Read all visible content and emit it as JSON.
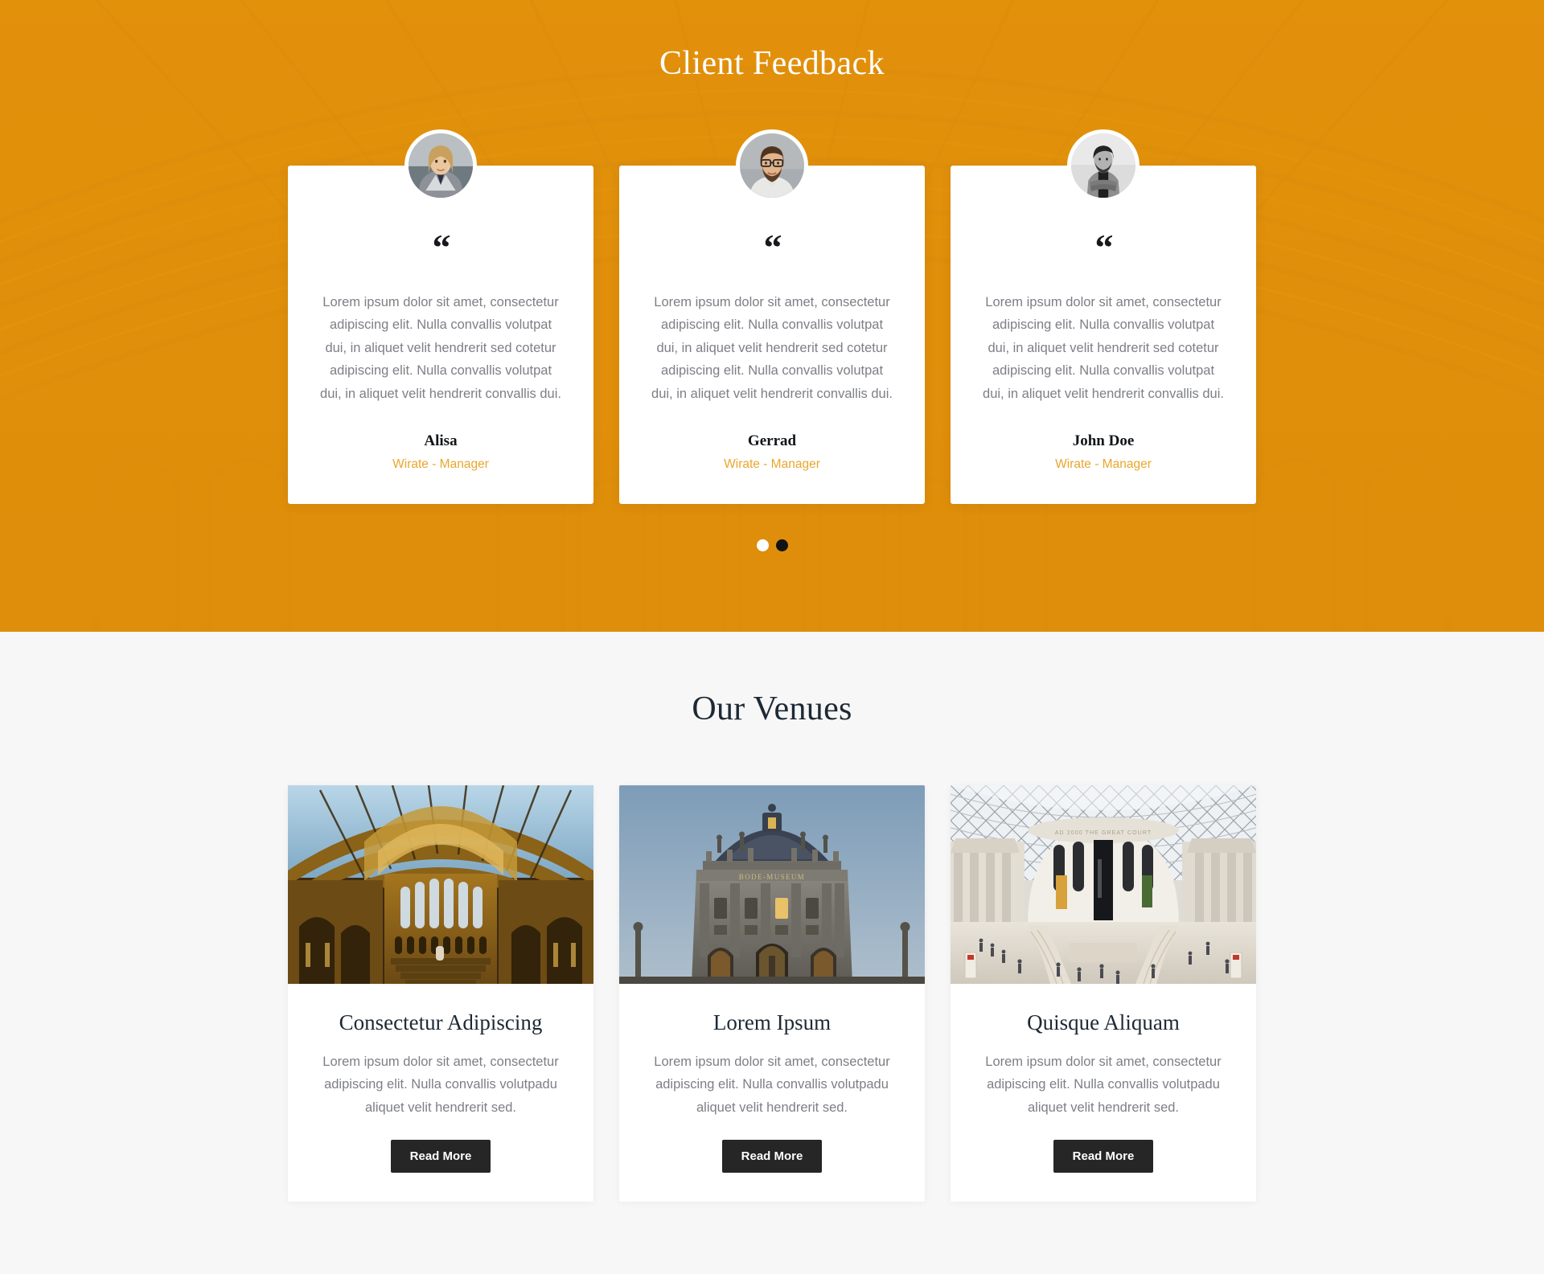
{
  "feedback": {
    "title": "Client Feedback",
    "accent_color": "#e9960c",
    "role_color": "#e9a62c",
    "quote_glyph": "“",
    "testimonials": [
      {
        "avatar": "woman-blonde-gray-blazer",
        "text": "Lorem ipsum dolor sit amet, consectetur adipiscing elit. Nulla convallis volutpat dui, in aliquet velit hendrerit sed cotetur adipiscing elit. Nulla convallis volutpat dui, in aliquet velit hendrerit convallis dui.",
        "name": "Alisa",
        "role": "Wirate - Manager"
      },
      {
        "avatar": "man-glasses-beard",
        "text": "Lorem ipsum dolor sit amet, consectetur adipiscing elit. Nulla convallis volutpat dui, in aliquet velit hendrerit sed cotetur adipiscing elit. Nulla convallis volutpat dui, in aliquet velit hendrerit convallis dui.",
        "name": "Gerrad",
        "role": "Wirate - Manager"
      },
      {
        "avatar": "man-crossed-arms-bw",
        "text": "Lorem ipsum dolor sit amet, consectetur adipiscing elit. Nulla convallis volutpat dui, in aliquet velit hendrerit sed cotetur adipiscing elit. Nulla convallis volutpat dui, in aliquet velit hendrerit convallis dui.",
        "name": "John Doe",
        "role": "Wirate - Manager"
      }
    ],
    "carousel": {
      "dots": [
        {
          "label": "slide-1",
          "active": false
        },
        {
          "label": "slide-2",
          "active": true
        }
      ]
    }
  },
  "venues": {
    "title": "Our Venues",
    "cards": [
      {
        "image": "museum-hall-interior-arched-ceiling",
        "title": "Consectetur Adipiscing",
        "text": "Lorem ipsum dolor sit amet, consectetur adipiscing elit. Nulla convallis volutpadu aliquet velit hendrerit sed.",
        "button": "Read More"
      },
      {
        "image": "domed-neoclassical-museum-exterior-dusk",
        "title": "Lorem Ipsum",
        "text": "Lorem ipsum dolor sit amet, consectetur adipiscing elit. Nulla convallis volutpadu aliquet velit hendrerit sed.",
        "button": "Read More"
      },
      {
        "image": "glass-roofed-museum-great-court",
        "title": "Quisque Aliquam",
        "text": "Lorem ipsum dolor sit amet, consectetur adipiscing elit. Nulla convallis volutpadu aliquet velit hendrerit sed.",
        "button": "Read More"
      }
    ]
  }
}
